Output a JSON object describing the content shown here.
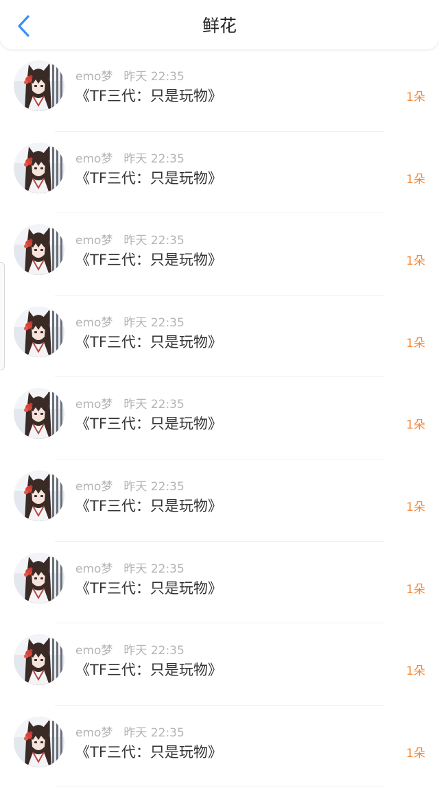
{
  "header": {
    "title": "鲜花",
    "back_icon": "chevron-left-icon",
    "accent_color": "#3a8ef6"
  },
  "items": [
    {
      "user": "emo梦",
      "time": "昨天 22:35",
      "book": "《TF三代：只是玩物》",
      "count": "1朵"
    },
    {
      "user": "emo梦",
      "time": "昨天 22:35",
      "book": "《TF三代：只是玩物》",
      "count": "1朵"
    },
    {
      "user": "emo梦",
      "time": "昨天 22:35",
      "book": "《TF三代：只是玩物》",
      "count": "1朵"
    },
    {
      "user": "emo梦",
      "time": "昨天 22:35",
      "book": "《TF三代：只是玩物》",
      "count": "1朵"
    },
    {
      "user": "emo梦",
      "time": "昨天 22:35",
      "book": "《TF三代：只是玩物》",
      "count": "1朵"
    },
    {
      "user": "emo梦",
      "time": "昨天 22:35",
      "book": "《TF三代：只是玩物》",
      "count": "1朵"
    },
    {
      "user": "emo梦",
      "time": "昨天 22:35",
      "book": "《TF三代：只是玩物》",
      "count": "1朵"
    },
    {
      "user": "emo梦",
      "time": "昨天 22:35",
      "book": "《TF三代：只是玩物》",
      "count": "1朵"
    },
    {
      "user": "emo梦",
      "time": "昨天 22:35",
      "book": "《TF三代：只是玩物》",
      "count": "1朵"
    }
  ],
  "colors": {
    "count": "#f58b3c",
    "meta": "#b4b4b4",
    "book": "#333333"
  }
}
